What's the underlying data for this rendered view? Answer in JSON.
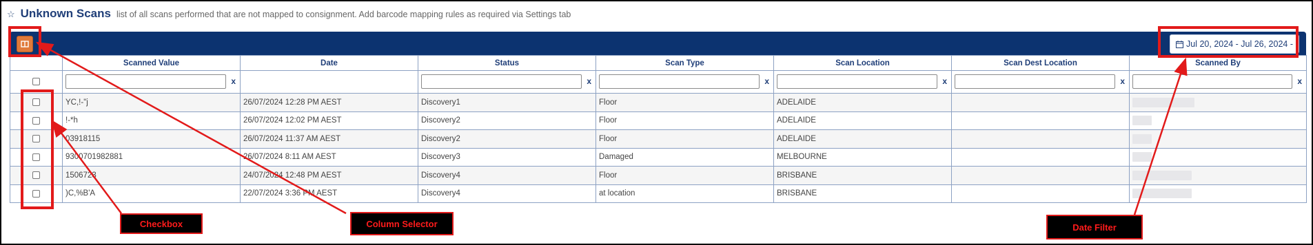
{
  "page": {
    "star_icon": "☆",
    "title": "Unknown Scans",
    "subtitle": "list of all scans performed that are not mapped to consignment. Add barcode mapping rules as required via Settings tab"
  },
  "toolbar": {
    "column_selector_icon": "book-open-icon",
    "date_range": "Jul 20, 2024 - Jul 26, 2024 -"
  },
  "table": {
    "columns": [
      "Scanned Value",
      "Date",
      "Status",
      "Scan Type",
      "Scan Location",
      "Scan Dest Location",
      "Scanned By"
    ],
    "filter_clear": "x",
    "rows": [
      {
        "value": "YC,!-\"j",
        "date": "26/07/2024 12:28 PM AEST",
        "status": "Discovery1",
        "type": "Floor",
        "location": "ADELAIDE",
        "dest": ""
      },
      {
        "value": "!-*h",
        "date": "26/07/2024 12:02 PM AEST",
        "status": "Discovery2",
        "type": "Floor",
        "location": "ADELAIDE",
        "dest": ""
      },
      {
        "value": "03918115",
        "date": "26/07/2024 11:37 AM AEST",
        "status": "Discovery2",
        "type": "Floor",
        "location": "ADELAIDE",
        "dest": ""
      },
      {
        "value": "9300701982881",
        "date": "26/07/2024 8:11 AM AEST",
        "status": "Discovery3",
        "type": "Damaged",
        "location": "MELBOURNE",
        "dest": ""
      },
      {
        "value": "1506723",
        "date": "24/07/2024 12:48 PM AEST",
        "status": "Discovery4",
        "type": "Floor",
        "location": "BRISBANE",
        "dest": ""
      },
      {
        "value": ")C,%B'A",
        "date": "22/07/2024 3:36 PM AEST",
        "status": "Discovery4",
        "type": "at location",
        "location": "BRISBANE",
        "dest": ""
      }
    ]
  },
  "annotations": {
    "checkbox": "Checkbox",
    "column_selector": "Column Selector",
    "date_filter": "Date Filter"
  },
  "colors": {
    "header_bar": "#0c3370",
    "accent_button": "#e07a3a",
    "annotation": "#e21a1a"
  }
}
